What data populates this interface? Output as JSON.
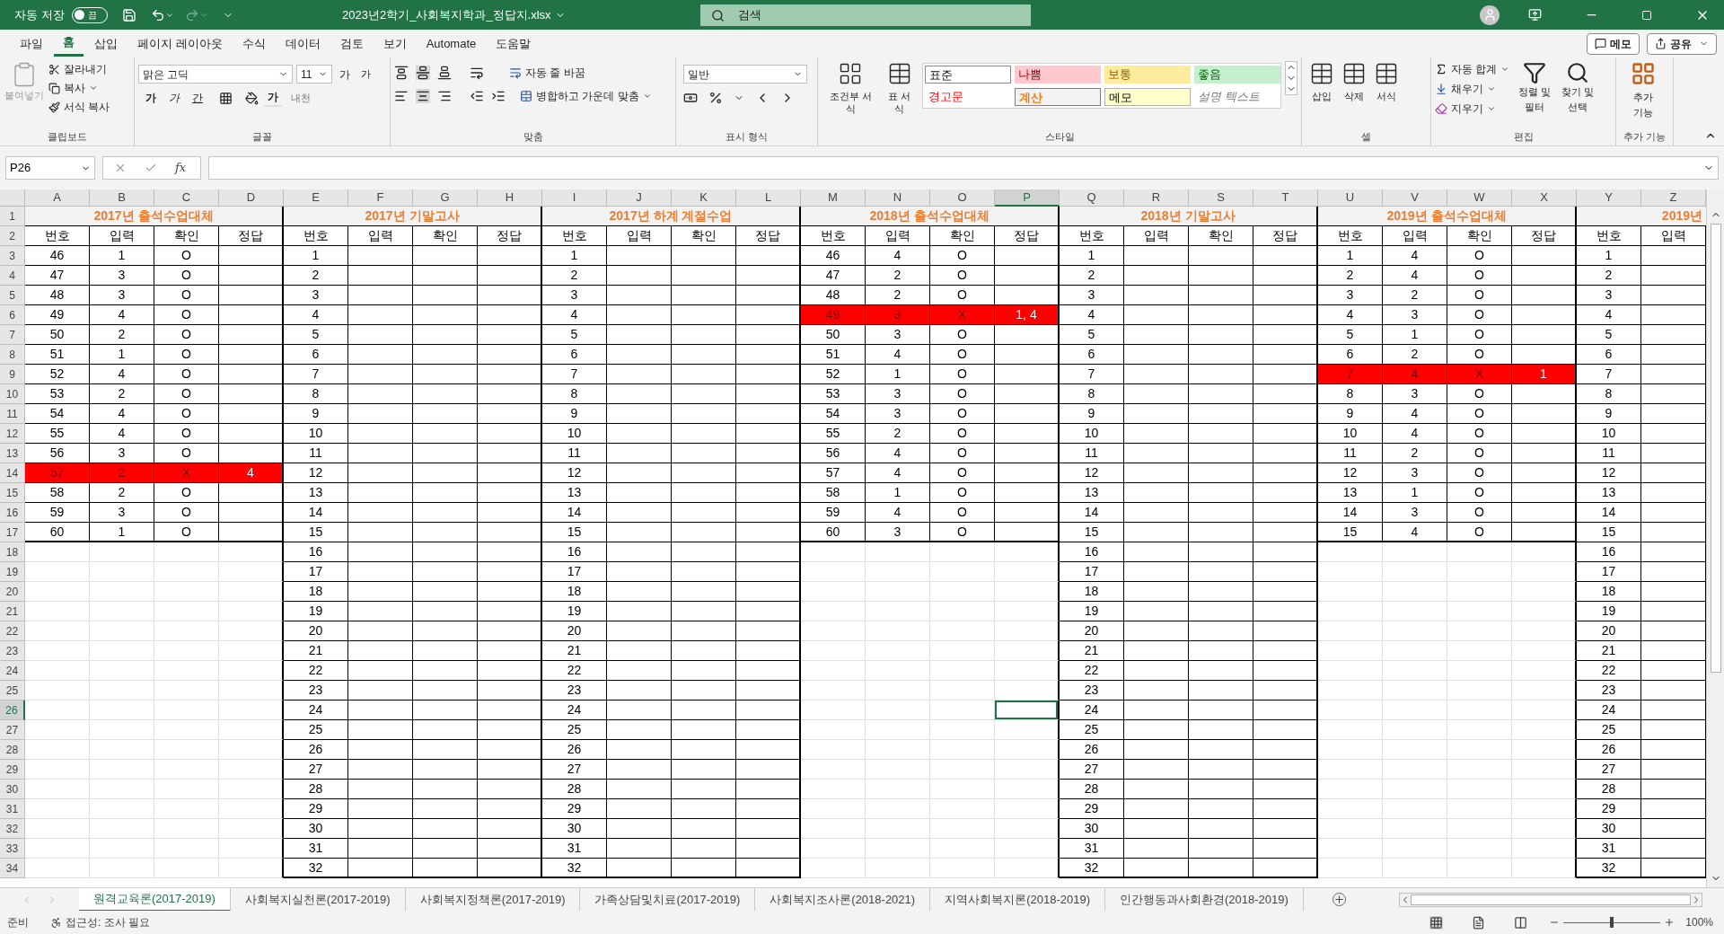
{
  "title_bar": {
    "autosave": {
      "label": "자동 저장",
      "on": false,
      "state_text": "끔"
    },
    "filename": "2023년2학기_사회복지학과_정답지.xlsx",
    "search": {
      "placeholder": "검색"
    }
  },
  "menu_tabs": [
    {
      "label": "파일",
      "selected": false
    },
    {
      "label": "홈",
      "selected": true
    },
    {
      "label": "삽입",
      "selected": false
    },
    {
      "label": "페이지 레이아웃",
      "selected": false
    },
    {
      "label": "수식",
      "selected": false
    },
    {
      "label": "데이터",
      "selected": false
    },
    {
      "label": "검토",
      "selected": false
    },
    {
      "label": "보기",
      "selected": false
    },
    {
      "label": "Automate",
      "selected": false
    },
    {
      "label": "도움말",
      "selected": false
    }
  ],
  "menu_buttons": [
    "메모",
    "공유"
  ],
  "ribbon": {
    "clipboard": {
      "label": "클립보드",
      "paste": {
        "label": "붙여넣기",
        "disabled": true
      },
      "cut": "잘라내기",
      "copy": "복사",
      "format_painter": "서식 복사"
    },
    "font": {
      "label": "글꼴",
      "font_name": "맑은 고딕",
      "font_size": "11",
      "grow": "가",
      "shrink": "가",
      "bold": "가",
      "italic": "가",
      "underline": "간",
      "font_color": "가",
      "phonetic": "내천"
    },
    "alignment": {
      "label": "맞춤",
      "wrap_text": "자동 줄 바꿈",
      "merge_center": "병합하고 가운데 맞춤"
    },
    "number": {
      "label": "표시 형식",
      "format": "일반"
    },
    "styles": {
      "label": "스타일",
      "conditional": "조건부 서식",
      "table": "표 서식",
      "cells": [
        {
          "label": "표준",
          "kind": "normal"
        },
        {
          "label": "나쁨",
          "kind": "bad"
        },
        {
          "label": "보통",
          "kind": "neutral"
        },
        {
          "label": "좋음",
          "kind": "good"
        },
        {
          "label": "경고문",
          "kind": "warning"
        },
        {
          "label": "계산",
          "kind": "calculation"
        },
        {
          "label": "메모",
          "kind": "note"
        },
        {
          "label": "설명 텍스트",
          "kind": "explanatory"
        }
      ]
    },
    "cells": {
      "label": "셀",
      "insert": "삽입",
      "delete": "삭제",
      "format": "서식"
    },
    "editing": {
      "label": "편집",
      "autosum": "자동 합계",
      "fill": "채우기",
      "clear": "지우기",
      "sort_filter": "정렬 및 필터",
      "find_select": "찾기 및 선택"
    },
    "addins": {
      "label": "추가 기능",
      "button": "추가 기능"
    }
  },
  "formula_bar": {
    "name_box": "P26",
    "function_label": "fx"
  },
  "sheet": {
    "column_letters": [
      {
        "label": "A",
        "selected": false
      },
      {
        "label": "B",
        "selected": false
      },
      {
        "label": "C",
        "selected": false
      },
      {
        "label": "D",
        "selected": false
      },
      {
        "label": "E",
        "selected": false
      },
      {
        "label": "F",
        "selected": false
      },
      {
        "label": "G",
        "selected": false
      },
      {
        "label": "H",
        "selected": false
      },
      {
        "label": "I",
        "selected": false
      },
      {
        "label": "J",
        "selected": false
      },
      {
        "label": "K",
        "selected": false
      },
      {
        "label": "L",
        "selected": false
      },
      {
        "label": "M",
        "selected": false
      },
      {
        "label": "N",
        "selected": false
      },
      {
        "label": "O",
        "selected": false
      },
      {
        "label": "P",
        "selected": true
      },
      {
        "label": "Q",
        "selected": false
      },
      {
        "label": "R",
        "selected": false
      },
      {
        "label": "S",
        "selected": false
      },
      {
        "label": "T",
        "selected": false
      },
      {
        "label": "U",
        "selected": false
      },
      {
        "label": "V",
        "selected": false
      },
      {
        "label": "W",
        "selected": false
      },
      {
        "label": "X",
        "selected": false
      },
      {
        "label": "Y",
        "selected": false
      },
      {
        "label": "Z",
        "selected": false
      }
    ],
    "row_numbers": [
      {
        "label": "1",
        "selected": false
      },
      {
        "label": "2",
        "selected": false
      },
      {
        "label": "3",
        "selected": false
      },
      {
        "label": "4",
        "selected": false
      },
      {
        "label": "5",
        "selected": false
      },
      {
        "label": "6",
        "selected": false
      },
      {
        "label": "7",
        "selected": false
      },
      {
        "label": "8",
        "selected": false
      },
      {
        "label": "9",
        "selected": false
      },
      {
        "label": "10",
        "selected": false
      },
      {
        "label": "11",
        "selected": false
      },
      {
        "label": "12",
        "selected": false
      },
      {
        "label": "13",
        "selected": false
      },
      {
        "label": "14",
        "selected": false
      },
      {
        "label": "15",
        "selected": false
      },
      {
        "label": "16",
        "selected": false
      },
      {
        "label": "17",
        "selected": false
      },
      {
        "label": "18",
        "selected": false
      },
      {
        "label": "19",
        "selected": false
      },
      {
        "label": "20",
        "selected": false
      },
      {
        "label": "21",
        "selected": false
      },
      {
        "label": "22",
        "selected": false
      },
      {
        "label": "23",
        "selected": false
      },
      {
        "label": "24",
        "selected": false
      },
      {
        "label": "25",
        "selected": false
      },
      {
        "label": "26",
        "selected": true
      },
      {
        "label": "27",
        "selected": false
      },
      {
        "label": "28",
        "selected": false
      },
      {
        "label": "29",
        "selected": false
      },
      {
        "label": "30",
        "selected": false
      },
      {
        "label": "31",
        "selected": false
      },
      {
        "label": "32",
        "selected": false
      },
      {
        "label": "33",
        "selected": false
      },
      {
        "label": "34",
        "selected": false
      }
    ],
    "blocks": [
      {
        "title": "2017년 출석수업대체",
        "clipped": false,
        "headers": [
          "번호",
          "입력",
          "확인",
          "정답"
        ],
        "records": [
          {
            "cells": [
              "46",
              "1",
              "O"
            ],
            "error": false
          },
          {
            "cells": [
              "47",
              "3",
              "O"
            ],
            "error": false
          },
          {
            "cells": [
              "48",
              "3",
              "O"
            ],
            "error": false
          },
          {
            "cells": [
              "49",
              "4",
              "O"
            ],
            "error": false
          },
          {
            "cells": [
              "50",
              "2",
              "O"
            ],
            "error": false
          },
          {
            "cells": [
              "51",
              "1",
              "O"
            ],
            "error": false
          },
          {
            "cells": [
              "52",
              "4",
              "O"
            ],
            "error": false
          },
          {
            "cells": [
              "53",
              "2",
              "O"
            ],
            "error": false
          },
          {
            "cells": [
              "54",
              "4",
              "O"
            ],
            "error": false
          },
          {
            "cells": [
              "55",
              "4",
              "O"
            ],
            "error": false
          },
          {
            "cells": [
              "56",
              "3",
              "O"
            ],
            "error": false
          },
          {
            "cells": [
              "57",
              "2",
              "X",
              "4"
            ],
            "error": true
          },
          {
            "cells": [
              "58",
              "2",
              "O"
            ],
            "error": false
          },
          {
            "cells": [
              "59",
              "3",
              "O"
            ],
            "error": false
          },
          {
            "cells": [
              "60",
              "1",
              "O"
            ],
            "error": false
          }
        ]
      },
      {
        "title": "2017년 기말고사",
        "clipped": false,
        "headers": [
          "번호",
          "입력",
          "확인",
          "정답"
        ],
        "records": [
          {
            "cells": [
              "1"
            ],
            "error": false
          },
          {
            "cells": [
              "2"
            ],
            "error": false
          },
          {
            "cells": [
              "3"
            ],
            "error": false
          },
          {
            "cells": [
              "4"
            ],
            "error": false
          },
          {
            "cells": [
              "5"
            ],
            "error": false
          },
          {
            "cells": [
              "6"
            ],
            "error": false
          },
          {
            "cells": [
              "7"
            ],
            "error": false
          },
          {
            "cells": [
              "8"
            ],
            "error": false
          },
          {
            "cells": [
              "9"
            ],
            "error": false
          },
          {
            "cells": [
              "10"
            ],
            "error": false
          },
          {
            "cells": [
              "11"
            ],
            "error": false
          },
          {
            "cells": [
              "12"
            ],
            "error": false
          },
          {
            "cells": [
              "13"
            ],
            "error": false
          },
          {
            "cells": [
              "14"
            ],
            "error": false
          },
          {
            "cells": [
              "15"
            ],
            "error": false
          },
          {
            "cells": [
              "16"
            ],
            "error": false
          },
          {
            "cells": [
              "17"
            ],
            "error": false
          },
          {
            "cells": [
              "18"
            ],
            "error": false
          },
          {
            "cells": [
              "19"
            ],
            "error": false
          },
          {
            "cells": [
              "20"
            ],
            "error": false
          },
          {
            "cells": [
              "21"
            ],
            "error": false
          },
          {
            "cells": [
              "22"
            ],
            "error": false
          },
          {
            "cells": [
              "23"
            ],
            "error": false
          },
          {
            "cells": [
              "24"
            ],
            "error": false
          },
          {
            "cells": [
              "25"
            ],
            "error": false
          },
          {
            "cells": [
              "26"
            ],
            "error": false
          },
          {
            "cells": [
              "27"
            ],
            "error": false
          },
          {
            "cells": [
              "28"
            ],
            "error": false
          },
          {
            "cells": [
              "29"
            ],
            "error": false
          },
          {
            "cells": [
              "30"
            ],
            "error": false
          },
          {
            "cells": [
              "31"
            ],
            "error": false
          },
          {
            "cells": [
              "32"
            ],
            "error": false
          }
        ]
      },
      {
        "title": "2017년 하계 계절수업",
        "clipped": false,
        "headers": [
          "번호",
          "입력",
          "확인",
          "정답"
        ],
        "records": [
          {
            "cells": [
              "1"
            ],
            "error": false
          },
          {
            "cells": [
              "2"
            ],
            "error": false
          },
          {
            "cells": [
              "3"
            ],
            "error": false
          },
          {
            "cells": [
              "4"
            ],
            "error": false
          },
          {
            "cells": [
              "5"
            ],
            "error": false
          },
          {
            "cells": [
              "6"
            ],
            "error": false
          },
          {
            "cells": [
              "7"
            ],
            "error": false
          },
          {
            "cells": [
              "8"
            ],
            "error": false
          },
          {
            "cells": [
              "9"
            ],
            "error": false
          },
          {
            "cells": [
              "10"
            ],
            "error": false
          },
          {
            "cells": [
              "11"
            ],
            "error": false
          },
          {
            "cells": [
              "12"
            ],
            "error": false
          },
          {
            "cells": [
              "13"
            ],
            "error": false
          },
          {
            "cells": [
              "14"
            ],
            "error": false
          },
          {
            "cells": [
              "15"
            ],
            "error": false
          },
          {
            "cells": [
              "16"
            ],
            "error": false
          },
          {
            "cells": [
              "17"
            ],
            "error": false
          },
          {
            "cells": [
              "18"
            ],
            "error": false
          },
          {
            "cells": [
              "19"
            ],
            "error": false
          },
          {
            "cells": [
              "20"
            ],
            "error": false
          },
          {
            "cells": [
              "21"
            ],
            "error": false
          },
          {
            "cells": [
              "22"
            ],
            "error": false
          },
          {
            "cells": [
              "23"
            ],
            "error": false
          },
          {
            "cells": [
              "24"
            ],
            "error": false
          },
          {
            "cells": [
              "25"
            ],
            "error": false
          },
          {
            "cells": [
              "26"
            ],
            "error": false
          },
          {
            "cells": [
              "27"
            ],
            "error": false
          },
          {
            "cells": [
              "28"
            ],
            "error": false
          },
          {
            "cells": [
              "29"
            ],
            "error": false
          },
          {
            "cells": [
              "30"
            ],
            "error": false
          },
          {
            "cells": [
              "31"
            ],
            "error": false
          },
          {
            "cells": [
              "32"
            ],
            "error": false
          }
        ]
      },
      {
        "title": "2018년 출석수업대체",
        "clipped": false,
        "headers": [
          "번호",
          "입력",
          "확인",
          "정답"
        ],
        "records": [
          {
            "cells": [
              "46",
              "4",
              "O"
            ],
            "error": false
          },
          {
            "cells": [
              "47",
              "2",
              "O"
            ],
            "error": false
          },
          {
            "cells": [
              "48",
              "2",
              "O"
            ],
            "error": false
          },
          {
            "cells": [
              "49",
              "3",
              "X",
              "1, 4"
            ],
            "error": true
          },
          {
            "cells": [
              "50",
              "3",
              "O"
            ],
            "error": false
          },
          {
            "cells": [
              "51",
              "4",
              "O"
            ],
            "error": false
          },
          {
            "cells": [
              "52",
              "1",
              "O"
            ],
            "error": false
          },
          {
            "cells": [
              "53",
              "3",
              "O"
            ],
            "error": false
          },
          {
            "cells": [
              "54",
              "3",
              "O"
            ],
            "error": false
          },
          {
            "cells": [
              "55",
              "2",
              "O"
            ],
            "error": false
          },
          {
            "cells": [
              "56",
              "4",
              "O"
            ],
            "error": false
          },
          {
            "cells": [
              "57",
              "4",
              "O"
            ],
            "error": false
          },
          {
            "cells": [
              "58",
              "1",
              "O"
            ],
            "error": false
          },
          {
            "cells": [
              "59",
              "4",
              "O"
            ],
            "error": false
          },
          {
            "cells": [
              "60",
              "3",
              "O"
            ],
            "error": false
          }
        ]
      },
      {
        "title": "2018년 기말고사",
        "clipped": false,
        "headers": [
          "번호",
          "입력",
          "확인",
          "정답"
        ],
        "records": [
          {
            "cells": [
              "1"
            ],
            "error": false
          },
          {
            "cells": [
              "2"
            ],
            "error": false
          },
          {
            "cells": [
              "3"
            ],
            "error": false
          },
          {
            "cells": [
              "4"
            ],
            "error": false
          },
          {
            "cells": [
              "5"
            ],
            "error": false
          },
          {
            "cells": [
              "6"
            ],
            "error": false
          },
          {
            "cells": [
              "7"
            ],
            "error": false
          },
          {
            "cells": [
              "8"
            ],
            "error": false
          },
          {
            "cells": [
              "9"
            ],
            "error": false
          },
          {
            "cells": [
              "10"
            ],
            "error": false
          },
          {
            "cells": [
              "11"
            ],
            "error": false
          },
          {
            "cells": [
              "12"
            ],
            "error": false
          },
          {
            "cells": [
              "13"
            ],
            "error": false
          },
          {
            "cells": [
              "14"
            ],
            "error": false
          },
          {
            "cells": [
              "15"
            ],
            "error": false
          },
          {
            "cells": [
              "16"
            ],
            "error": false
          },
          {
            "cells": [
              "17"
            ],
            "error": false
          },
          {
            "cells": [
              "18"
            ],
            "error": false
          },
          {
            "cells": [
              "19"
            ],
            "error": false
          },
          {
            "cells": [
              "20"
            ],
            "error": false
          },
          {
            "cells": [
              "21"
            ],
            "error": false
          },
          {
            "cells": [
              "22"
            ],
            "error": false
          },
          {
            "cells": [
              "23"
            ],
            "error": false
          },
          {
            "cells": [
              "24"
            ],
            "error": false
          },
          {
            "cells": [
              "25"
            ],
            "error": false
          },
          {
            "cells": [
              "26"
            ],
            "error": false
          },
          {
            "cells": [
              "27"
            ],
            "error": false
          },
          {
            "cells": [
              "28"
            ],
            "error": false
          },
          {
            "cells": [
              "29"
            ],
            "error": false
          },
          {
            "cells": [
              "30"
            ],
            "error": false
          },
          {
            "cells": [
              "31"
            ],
            "error": false
          },
          {
            "cells": [
              "32"
            ],
            "error": false
          }
        ]
      },
      {
        "title": "2019년 출석수업대체",
        "clipped": false,
        "headers": [
          "번호",
          "입력",
          "확인",
          "정답"
        ],
        "records": [
          {
            "cells": [
              "1",
              "4",
              "O"
            ],
            "error": false
          },
          {
            "cells": [
              "2",
              "4",
              "O"
            ],
            "error": false
          },
          {
            "cells": [
              "3",
              "2",
              "O"
            ],
            "error": false
          },
          {
            "cells": [
              "4",
              "3",
              "O"
            ],
            "error": false
          },
          {
            "cells": [
              "5",
              "1",
              "O"
            ],
            "error": false
          },
          {
            "cells": [
              "6",
              "2",
              "O"
            ],
            "error": false
          },
          {
            "cells": [
              "7",
              "4",
              "X",
              "1"
            ],
            "error": true
          },
          {
            "cells": [
              "8",
              "3",
              "O"
            ],
            "error": false
          },
          {
            "cells": [
              "9",
              "4",
              "O"
            ],
            "error": false
          },
          {
            "cells": [
              "10",
              "4",
              "O"
            ],
            "error": false
          },
          {
            "cells": [
              "11",
              "2",
              "O"
            ],
            "error": false
          },
          {
            "cells": [
              "12",
              "3",
              "O"
            ],
            "error": false
          },
          {
            "cells": [
              "13",
              "1",
              "O"
            ],
            "error": false
          },
          {
            "cells": [
              "14",
              "3",
              "O"
            ],
            "error": false
          },
          {
            "cells": [
              "15",
              "4",
              "O"
            ],
            "error": false
          }
        ]
      },
      {
        "title": "2019년",
        "clipped": true,
        "headers": [
          "번호",
          "입력"
        ],
        "records": [
          {
            "cells": [
              "1"
            ],
            "error": false
          },
          {
            "cells": [
              "2"
            ],
            "error": false
          },
          {
            "cells": [
              "3"
            ],
            "error": false
          },
          {
            "cells": [
              "4"
            ],
            "error": false
          },
          {
            "cells": [
              "5"
            ],
            "error": false
          },
          {
            "cells": [
              "6"
            ],
            "error": false
          },
          {
            "cells": [
              "7"
            ],
            "error": false
          },
          {
            "cells": [
              "8"
            ],
            "error": false
          },
          {
            "cells": [
              "9"
            ],
            "error": false
          },
          {
            "cells": [
              "10"
            ],
            "error": false
          },
          {
            "cells": [
              "11"
            ],
            "error": false
          },
          {
            "cells": [
              "12"
            ],
            "error": false
          },
          {
            "cells": [
              "13"
            ],
            "error": false
          },
          {
            "cells": [
              "14"
            ],
            "error": false
          },
          {
            "cells": [
              "15"
            ],
            "error": false
          },
          {
            "cells": [
              "16"
            ],
            "error": false
          },
          {
            "cells": [
              "17"
            ],
            "error": false
          },
          {
            "cells": [
              "18"
            ],
            "error": false
          },
          {
            "cells": [
              "19"
            ],
            "error": false
          },
          {
            "cells": [
              "20"
            ],
            "error": false
          },
          {
            "cells": [
              "21"
            ],
            "error": false
          },
          {
            "cells": [
              "22"
            ],
            "error": false
          },
          {
            "cells": [
              "23"
            ],
            "error": false
          },
          {
            "cells": [
              "24"
            ],
            "error": false
          },
          {
            "cells": [
              "25"
            ],
            "error": false
          },
          {
            "cells": [
              "26"
            ],
            "error": false
          },
          {
            "cells": [
              "27"
            ],
            "error": false
          },
          {
            "cells": [
              "28"
            ],
            "error": false
          },
          {
            "cells": [
              "29"
            ],
            "error": false
          },
          {
            "cells": [
              "30"
            ],
            "error": false
          },
          {
            "cells": [
              "31"
            ],
            "error": false
          },
          {
            "cells": [
              "32"
            ],
            "error": false
          }
        ]
      }
    ]
  },
  "sheet_tabs": [
    {
      "label": "원격교육론(2017-2019)",
      "selected": true
    },
    {
      "label": "사회복지실천론(2017-2019)",
      "selected": false
    },
    {
      "label": "사회복지정책론(2017-2019)",
      "selected": false
    },
    {
      "label": "가족상담및치료(2017-2019)",
      "selected": false
    },
    {
      "label": "사회복지조사론(2018-2021)",
      "selected": false
    },
    {
      "label": "지역사회복지론(2018-2019)",
      "selected": false
    },
    {
      "label": "인간행동과사회환경(2018-2019)",
      "selected": false
    }
  ],
  "status_bar": {
    "ready": "준비",
    "accessibility": "접근성: 조사 필요",
    "zoom": {
      "level": 0.5,
      "reading": "100%"
    }
  }
}
